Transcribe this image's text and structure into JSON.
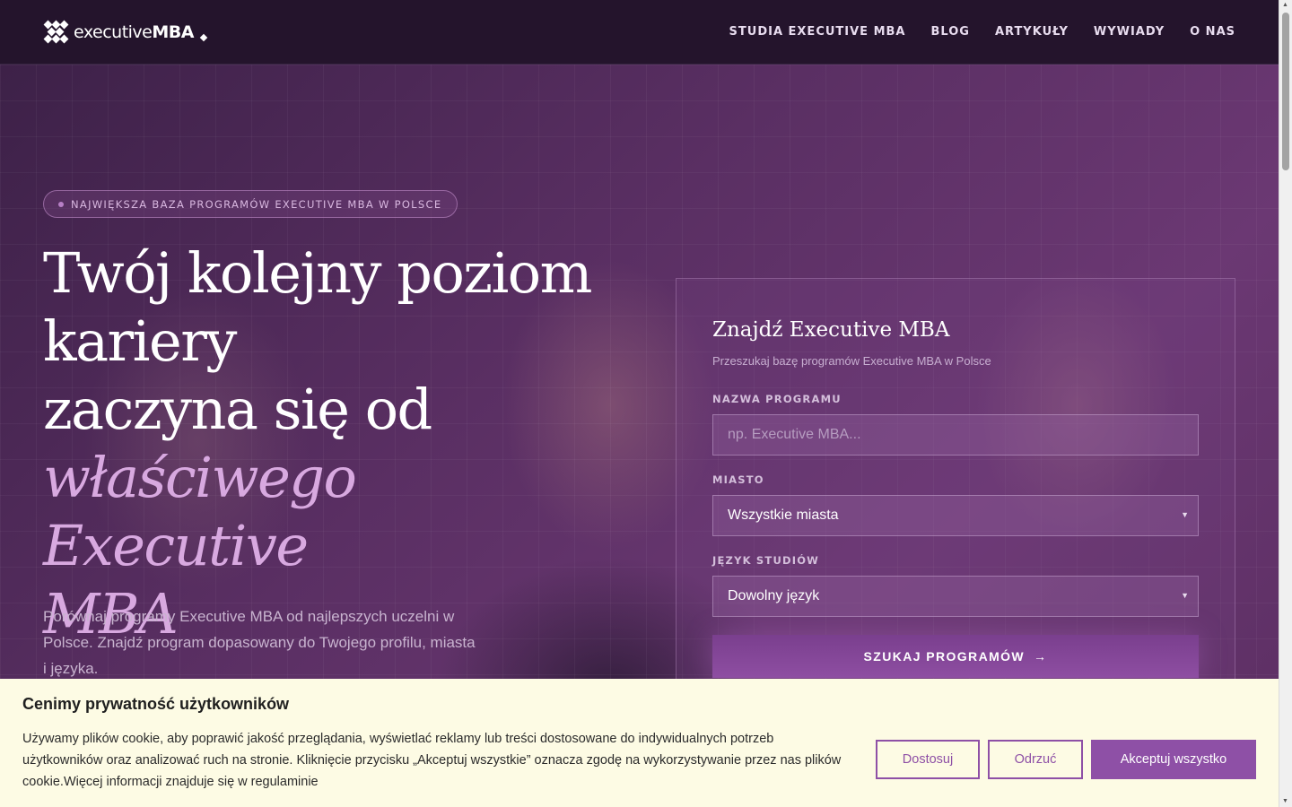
{
  "logo": {
    "text_light": "executive",
    "text_bold": "MBA"
  },
  "nav": [
    {
      "label": "STUDIA EXECUTIVE MBA"
    },
    {
      "label": "BLOG"
    },
    {
      "label": "ARTYKUŁY"
    },
    {
      "label": "WYWIADY"
    },
    {
      "label": "O NAS"
    }
  ],
  "hero": {
    "badge": "NAJWIĘKSZA BAZA PROGRAMÓW EXECUTIVE MBA W POLSCE",
    "headline_line1": "Twój kolejny poziom",
    "headline_line2": "kariery",
    "headline_line3": "zaczyna się od",
    "headline_accent_line1": "właściwego Executive",
    "headline_accent_line2": "MBA",
    "lead": "Porównaj programy Executive MBA od najlepszych uczelni w Polsce. Znajdź program dopasowany do Twojego profilu, miasta i języka."
  },
  "search_card": {
    "title": "Znajdź Executive MBA",
    "subtitle": "Przeszukaj bazę programów Executive MBA w Polsce",
    "program_label": "NAZWA PROGRAMU",
    "program_placeholder": "np. Executive MBA...",
    "city_label": "MIASTO",
    "city_value": "Wszystkie miasta",
    "language_label": "JĘZYK STUDIÓW",
    "language_value": "Dowolny język",
    "button_label": "SZUKAJ PROGRAMÓW",
    "button_arrow": "→"
  },
  "cookie": {
    "title": "Cenimy prywatność użytkowników",
    "text": "Używamy plików cookie, aby poprawić jakość przeglądania, wyświetlać reklamy lub treści dostosowane do indywidualnych potrzeb użytkowników oraz analizować ruch na stronie. Kliknięcie przycisku „Akceptuj wszystkie” oznacza zgodę na wykorzystywanie przez nas plików cookie.Więcej informacji znajduje się w regulaminie",
    "customize_label": "Dostosuj",
    "reject_label": "Odrzuć",
    "accept_label": "Akceptuj wszystko"
  },
  "colors": {
    "header_bg": "#24142c",
    "accent": "#8e50a6",
    "headline_accent": "#d8a9e0",
    "cookie_bg": "#fdfbe4"
  }
}
